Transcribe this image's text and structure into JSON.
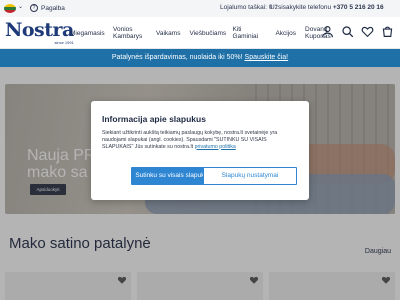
{
  "topbar": {
    "help_label": "Pagalba",
    "loyalty_text": "Lojalumo taškai: 0",
    "order_prefix": "Užsisakykite telefonu",
    "order_phone": "+370 5 216 20 16"
  },
  "header": {
    "logo_text": "Nostra",
    "logo_since": "since 1991",
    "nav": [
      {
        "label": "Miegamasis"
      },
      {
        "label": "Vonios Kambarys"
      },
      {
        "label": "Vaikams"
      },
      {
        "label": "Viešbučiams"
      },
      {
        "label": "Kiti Gaminiai"
      },
      {
        "label": "Akcijos"
      },
      {
        "label": "Dovanų Kuponas"
      }
    ],
    "icons": [
      "user-icon",
      "search-icon",
      "wishlist-icon",
      "cart-icon"
    ]
  },
  "promo": {
    "text": "Patalynės išpardavimas, nuolaida iki 50%!",
    "link": "Spauskite čia!"
  },
  "hero": {
    "title_line1": "Nauja PR",
    "title_line2": "mako sa",
    "button": "Apsiduokyti"
  },
  "cookie_modal": {
    "title": "Informacija apie slapukus",
    "body": "Siekiant užtikrinti aukštą teikiamų paslaugų kokybę, nostra.lt svetainėje yra naudojami slapukai (angl. cookies). Spausdami \"SUTINKU SU VISAIS SLAPUKAIS\" Jūs sutinkate su nostra.lt",
    "policy_link": "privatumo politika",
    "accept_button": "Sutinku su visais slapukais",
    "settings_button": "Slapukų nustatymai"
  },
  "section": {
    "title": "Mako satino patalynė",
    "more_link": "Daugiau"
  },
  "colors": {
    "brand": "#1e3a78",
    "promo_bar": "#1e70a7",
    "accent_button": "#2e86d3"
  }
}
